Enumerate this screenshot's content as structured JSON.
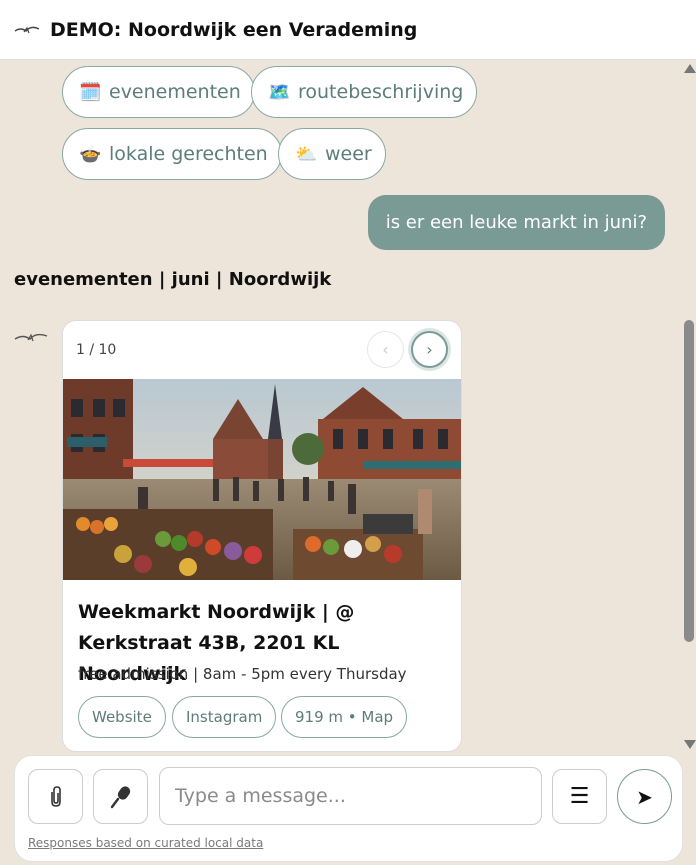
{
  "header": {
    "title": "DEMO: Noordwijk een Verademing",
    "logo_icon": "seagull-icon"
  },
  "chips": [
    {
      "emoji": "🗓️",
      "label": "evenementen"
    },
    {
      "emoji": "🗺️",
      "label": "routebeschrijving"
    },
    {
      "emoji": "🍲",
      "label": "lokale gerechten"
    },
    {
      "emoji": "⛅",
      "label": "weer"
    }
  ],
  "user_message": "is er een leuke markt in juni?",
  "section_title": "evenementen | juni | Noordwijk",
  "card": {
    "counter": "1 / 10",
    "prev_label": "‹",
    "next_label": "›",
    "image_alt": "market scene",
    "title": "Weekmarkt Noordwijk | @ Kerkstraat 43B, 2201 KL Noordwijk",
    "meta": "free admission | 8am - 5pm every Thursday",
    "links": [
      "Website",
      "Instagram",
      "919 m • Map"
    ]
  },
  "composer": {
    "placeholder": "Type a message...",
    "attach_icon": "paperclip-icon",
    "mic_icon": "microphone-icon",
    "menu_label": "☰",
    "send_label": "➤",
    "footnote": "Responses based on curated local data"
  },
  "colors": {
    "accent": "#7a9a96",
    "chip_text": "#5d7d79",
    "background": "#ede4da"
  }
}
